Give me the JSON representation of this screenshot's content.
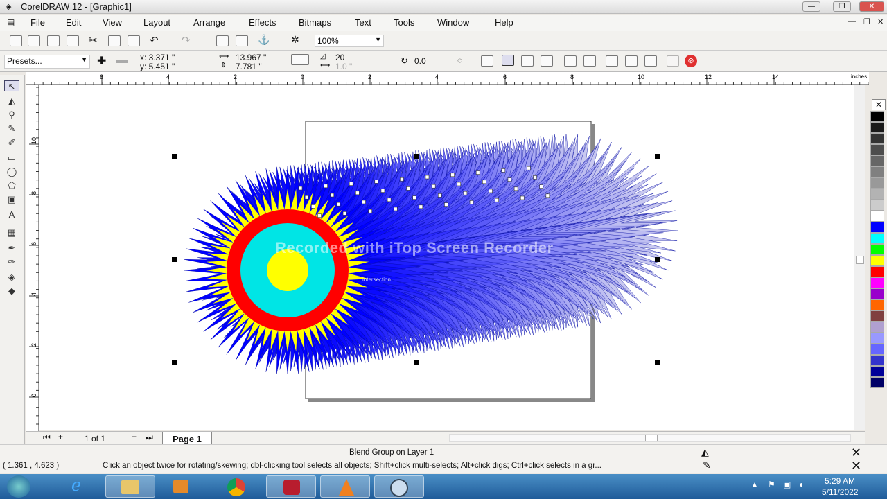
{
  "window": {
    "title": "CorelDRAW 12 - [Graphic1]"
  },
  "menu": [
    "File",
    "Edit",
    "View",
    "Layout",
    "Arrange",
    "Effects",
    "Bitmaps",
    "Text",
    "Tools",
    "Window",
    "Help"
  ],
  "toolbar": {
    "zoom": "100%"
  },
  "propertybar": {
    "presets": "Presets...",
    "x": "x: 3.371 \"",
    "y": "y: 5.451 \"",
    "width": "13.967 \"",
    "height": "7.781 \"",
    "steps": "20",
    "spacing": "1.0 \"",
    "rotation": "0.0"
  },
  "rulers": {
    "h_labels": [
      "6",
      "4",
      "2",
      "0",
      "2",
      "4",
      "6",
      "8",
      "10",
      "12",
      "14"
    ],
    "h_unit": "inches",
    "v_labels": [
      "10",
      "8",
      "6",
      "4",
      "2",
      "0"
    ],
    "v_unit": "inches"
  },
  "canvas": {
    "watermark": "Recorded with iTop Screen Recorder",
    "snap_hint": "intersection"
  },
  "pagebar": {
    "page_count": "1 of 1",
    "page_tab": "Page 1"
  },
  "status": {
    "selection": "Blend Group on Layer 1",
    "coords": "( 1.361 , 4.623 )",
    "hint": "Click an object twice for rotating/skewing; dbl-clicking tool selects all objects; Shift+click multi-selects; Alt+click digs; Ctrl+click selects in a gr..."
  },
  "taskbar": {
    "time": "5:29 AM",
    "date": "5/11/2022",
    "apps": [
      "start",
      "internet-explorer",
      "file-explorer",
      "media-player",
      "chrome",
      "itop-recorder",
      "vlc",
      "coreldraw"
    ]
  },
  "palette": [
    "#000000",
    "#1a1a1a",
    "#333333",
    "#4d4d4d",
    "#666666",
    "#808080",
    "#999999",
    "#b3b3b3",
    "#cccccc",
    "#ffffff",
    "#0000ff",
    "#00ffff",
    "#00ff00",
    "#ffff00",
    "#ff0000",
    "#ff00ff",
    "#9900cc",
    "#ff6600",
    "#804040",
    "#b0a0d0",
    "#9999ff",
    "#6666ff",
    "#3333cc",
    "#000099",
    "#000066"
  ],
  "colors": {
    "blend_start": "#0000ff",
    "blend_end": "#c8c8f0",
    "ring_red": "#ff0000",
    "ring_yellow": "#ffff00",
    "ring_cyan": "#00e5e5"
  }
}
